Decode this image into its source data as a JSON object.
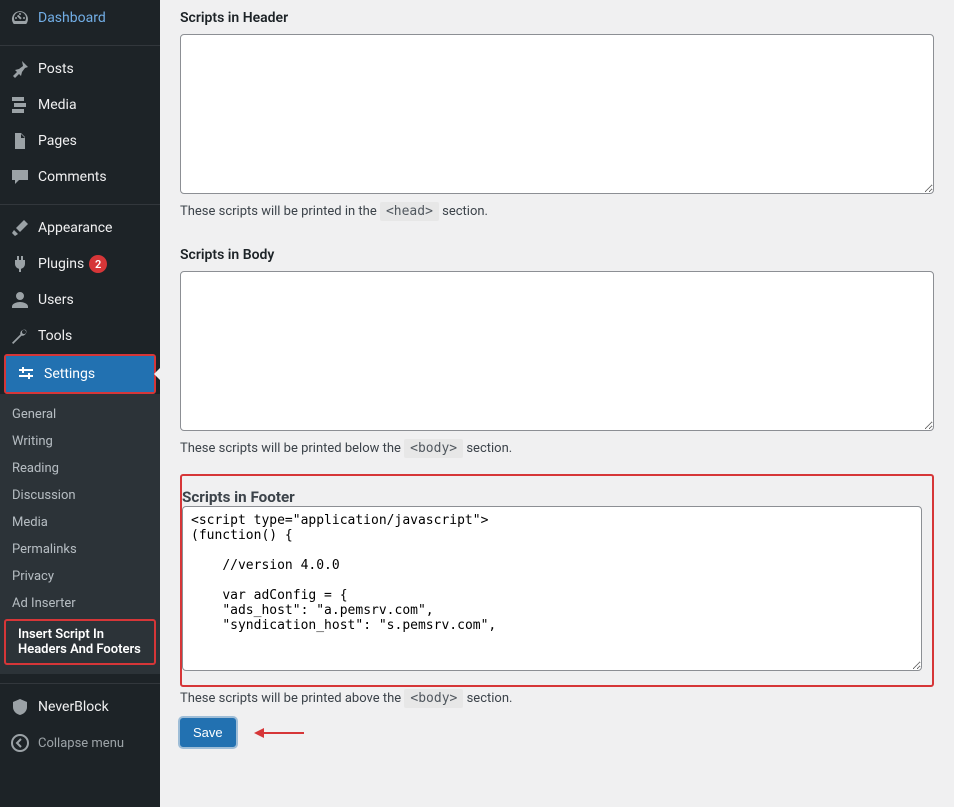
{
  "sidebar": {
    "dashboard": "Dashboard",
    "posts": "Posts",
    "media": "Media",
    "pages": "Pages",
    "comments": "Comments",
    "appearance": "Appearance",
    "plugins": "Plugins",
    "plugins_badge": "2",
    "users": "Users",
    "tools": "Tools",
    "settings": "Settings",
    "sub": {
      "general": "General",
      "writing": "Writing",
      "reading": "Reading",
      "discussion": "Discussion",
      "media": "Media",
      "permalinks": "Permalinks",
      "privacy": "Privacy",
      "ad_inserter": "Ad Inserter",
      "insert_script": "Insert Script In Headers And Footers"
    },
    "neverblock": "NeverBlock",
    "collapse": "Collapse menu"
  },
  "sections": {
    "header": {
      "title": "Scripts in Header",
      "value": "",
      "help_pre": "These scripts will be printed in the ",
      "help_code": "<head>",
      "help_post": " section."
    },
    "body": {
      "title": "Scripts in Body",
      "value": "",
      "help_pre": "These scripts will be printed below the ",
      "help_code": "<body>",
      "help_post": " section."
    },
    "footer": {
      "title": "Scripts in Footer",
      "value": "<script type=\"application/javascript\">\n(function() {\n\n    //version 4.0.0\n\n    var adConfig = {\n    \"ads_host\": \"a.pemsrv.com\",\n    \"syndication_host\": \"s.pemsrv.com\",",
      "help_pre": "These scripts will be printed above the ",
      "help_code": "<body>",
      "help_post": " section."
    }
  },
  "save_label": "Save"
}
